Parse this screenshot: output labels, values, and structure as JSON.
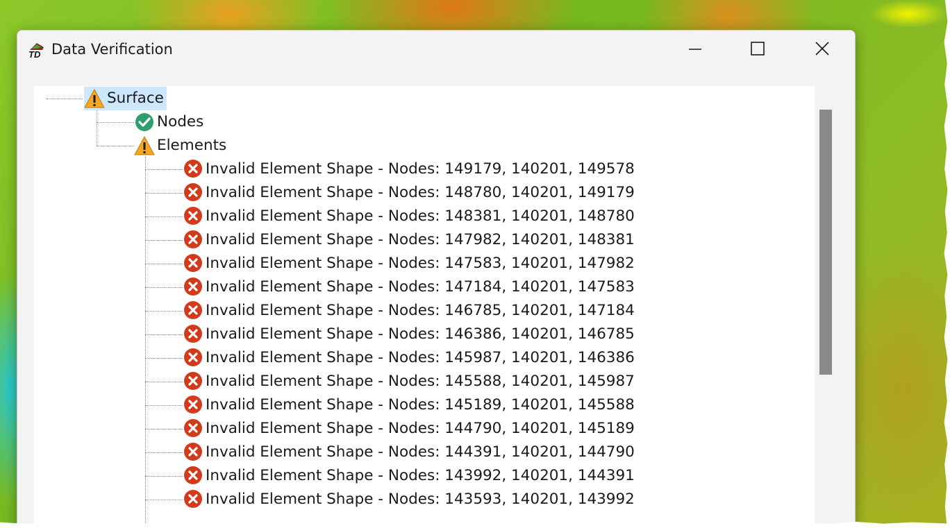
{
  "window": {
    "title": "Data Verification"
  },
  "tree": {
    "root": {
      "label": "Surface",
      "status": "warning-icon"
    },
    "children": [
      {
        "label": "Nodes",
        "status": "check-circle-icon"
      },
      {
        "label": "Elements",
        "status": "warning-icon"
      }
    ],
    "element_errors": [
      "Invalid Element Shape - Nodes: 149179, 140201, 149578",
      "Invalid Element Shape - Nodes: 148780, 140201, 149179",
      "Invalid Element Shape - Nodes: 148381, 140201, 148780",
      "Invalid Element Shape - Nodes: 147982, 140201, 148381",
      "Invalid Element Shape - Nodes: 147583, 140201, 147982",
      "Invalid Element Shape - Nodes: 147184, 140201, 147583",
      "Invalid Element Shape - Nodes: 146785, 140201, 147184",
      "Invalid Element Shape - Nodes: 146386, 140201, 146785",
      "Invalid Element Shape - Nodes: 145987, 140201, 146386",
      "Invalid Element Shape - Nodes: 145588, 140201, 145987",
      "Invalid Element Shape - Nodes: 145189, 140201, 145588",
      "Invalid Element Shape - Nodes: 144790, 140201, 145189",
      "Invalid Element Shape - Nodes: 144391, 140201, 144790",
      "Invalid Element Shape - Nodes: 143992, 140201, 144391",
      "Invalid Element Shape - Nodes: 143593, 140201, 143992"
    ]
  },
  "colors": {
    "selection": "#cce8ff",
    "warning": "#f5a623",
    "success": "#2e9e6e",
    "error": "#d13b1c",
    "scroll_thumb": "#8a8a8a"
  }
}
